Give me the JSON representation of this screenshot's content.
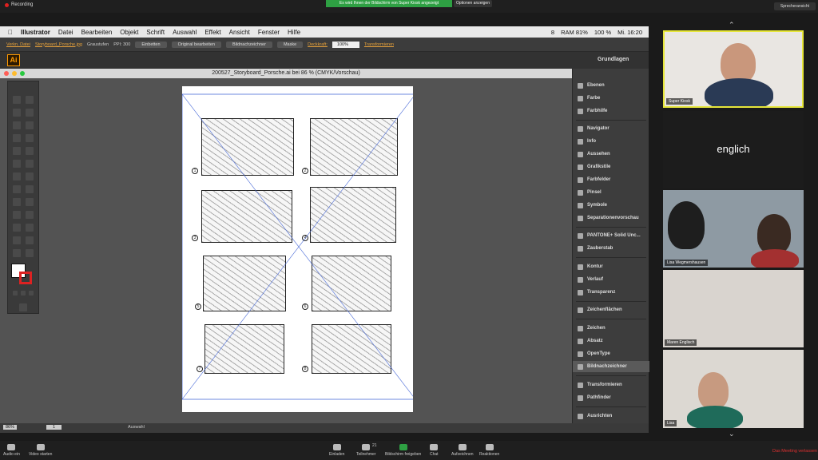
{
  "zoom_top": {
    "recording": "Recording",
    "share_banner": "Es wird Ihnen der Bildschirm von Super Kiosk angezeigt",
    "options": "Optionen anzeigen",
    "speaker_view": "Sprecheransicht"
  },
  "mac_menu": {
    "app": "Illustrator",
    "items": [
      "Datei",
      "Bearbeiten",
      "Objekt",
      "Schrift",
      "Auswahl",
      "Effekt",
      "Ansicht",
      "Fenster",
      "Hilfe"
    ],
    "status": [
      "8",
      "RAM 81%",
      "100 %",
      "Mi. 16:20"
    ]
  },
  "control_bar": {
    "link_file": "Verkn. Datei",
    "file_name": "Storyboard_Porsche.jpg",
    "mode": "Graustufen",
    "ppi": "PPI: 300",
    "embed": "Einbetten",
    "edit_original": "Original bearbeiten",
    "trace": "Bildnachzeichner",
    "mask": "Maske",
    "opacity_label": "Deckkraft:",
    "opacity_value": "100%",
    "transform": "Transformieren"
  },
  "app_bar": {
    "logo": "Ai",
    "workspace": "Grundlagen"
  },
  "document": {
    "title": "200527_Storyboard_Porsche.ai bei 86 % (CMYK/Vorschau)"
  },
  "storyboard": {
    "frame_numbers": [
      "1",
      "2",
      "3",
      "4",
      "5",
      "6",
      "7",
      "8"
    ]
  },
  "status_bar": {
    "zoom": "86%",
    "page": "1",
    "state": "Auswahl"
  },
  "panel": {
    "items": [
      "Ebenen",
      "Farbe",
      "Farbhilfe",
      "Navigator",
      "Info",
      "Aussehen",
      "Grafikstile",
      "Farbfelder",
      "Pinsel",
      "Symbole",
      "Separationenvorschau",
      "PANTONE+ Solid Unc...",
      "Zauberstab",
      "Kontur",
      "Verlauf",
      "Transparenz",
      "Zeichenflächen",
      "Zeichen",
      "Absatz",
      "OpenType",
      "Bildnachzeichner",
      "Transformieren",
      "Pathfinder",
      "Ausrichten"
    ]
  },
  "participants": [
    {
      "name": "Super Kiosk",
      "label": ""
    },
    {
      "name": "",
      "label": "englich"
    },
    {
      "name": "Lisa Wegmershausen",
      "label": ""
    },
    {
      "name": "Maren Englisch",
      "label": ""
    },
    {
      "name": "Lisa",
      "label": ""
    }
  ],
  "zoom_bottom": {
    "audio": "Audio ein",
    "video": "Video starten",
    "invite": "Einladen",
    "participants": "Teilnehmer",
    "participants_count": "21",
    "share": "Bildschirm freigeben",
    "chat": "Chat",
    "record": "Aufzeichnen",
    "reactions": "Reaktionen",
    "leave": "Das Meeting verlassen"
  },
  "colors": {
    "zoom_green": "#2ea043",
    "ai_orange": "#ff9a00",
    "leave_red": "#e03030",
    "active_speaker": "#e6e63a"
  }
}
